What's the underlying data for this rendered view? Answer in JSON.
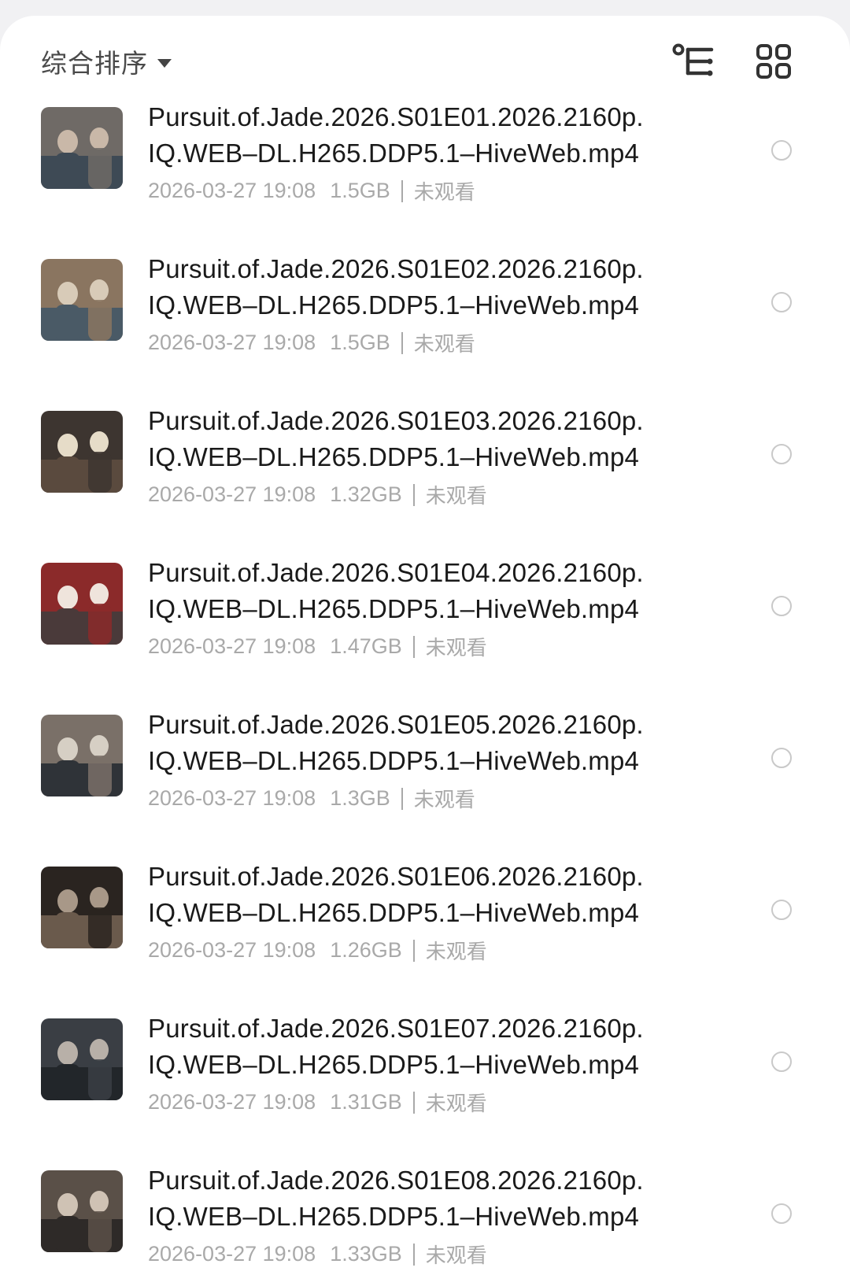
{
  "toolbar": {
    "sort_label": "综合排序",
    "sort_caret_icon": "caret-down-icon",
    "tree_view_icon": "tree-view-icon",
    "grid_view_icon": "grid-view-icon"
  },
  "files": [
    {
      "title_line1": "Pursuit.of.Jade.2026.S01E01.2026.2160p.",
      "title_line2": "IQ.WEB–DL.H265.DDP5.1–HiveWeb.mp4",
      "date": "2026-03-27 19:08",
      "size": "1.5GB",
      "status": "未观看",
      "palette": [
        "#6f6a66",
        "#c9b8a8",
        "#3e4a55"
      ]
    },
    {
      "title_line1": "Pursuit.of.Jade.2026.S01E02.2026.2160p.",
      "title_line2": "IQ.WEB–DL.H265.DDP5.1–HiveWeb.mp4",
      "date": "2026-03-27 19:08",
      "size": "1.5GB",
      "status": "未观看",
      "palette": [
        "#8a7560",
        "#d8cbb8",
        "#4a5a66"
      ]
    },
    {
      "title_line1": "Pursuit.of.Jade.2026.S01E03.2026.2160p.",
      "title_line2": "IQ.WEB–DL.H265.DDP5.1–HiveWeb.mp4",
      "date": "2026-03-27 19:08",
      "size": "1.32GB",
      "status": "未观看",
      "palette": [
        "#3d3530",
        "#e6dcc8",
        "#5a4a3e"
      ]
    },
    {
      "title_line1": "Pursuit.of.Jade.2026.S01E04.2026.2160p.",
      "title_line2": "IQ.WEB–DL.H265.DDP5.1–HiveWeb.mp4",
      "date": "2026-03-27 19:08",
      "size": "1.47GB",
      "status": "未观看",
      "palette": [
        "#8b2a2a",
        "#efe4dc",
        "#4a3a3a"
      ]
    },
    {
      "title_line1": "Pursuit.of.Jade.2026.S01E05.2026.2160p.",
      "title_line2": "IQ.WEB–DL.H265.DDP5.1–HiveWeb.mp4",
      "date": "2026-03-27 19:08",
      "size": "1.3GB",
      "status": "未观看",
      "palette": [
        "#7a7068",
        "#d6cfc4",
        "#2f3338"
      ]
    },
    {
      "title_line1": "Pursuit.of.Jade.2026.S01E06.2026.2160p.",
      "title_line2": "IQ.WEB–DL.H265.DDP5.1–HiveWeb.mp4",
      "date": "2026-03-27 19:08",
      "size": "1.26GB",
      "status": "未观看",
      "palette": [
        "#2a2420",
        "#a89888",
        "#6a5a4c"
      ]
    },
    {
      "title_line1": "Pursuit.of.Jade.2026.S01E07.2026.2160p.",
      "title_line2": "IQ.WEB–DL.H265.DDP5.1–HiveWeb.mp4",
      "date": "2026-03-27 19:08",
      "size": "1.31GB",
      "status": "未观看",
      "palette": [
        "#3a3e44",
        "#b8b0a8",
        "#22262a"
      ]
    },
    {
      "title_line1": "Pursuit.of.Jade.2026.S01E08.2026.2160p.",
      "title_line2": "IQ.WEB–DL.H265.DDP5.1–HiveWeb.mp4",
      "date": "2026-03-27 19:08",
      "size": "1.33GB",
      "status": "未观看",
      "palette": [
        "#5a5048",
        "#cfc2b4",
        "#2e2a28"
      ]
    }
  ]
}
